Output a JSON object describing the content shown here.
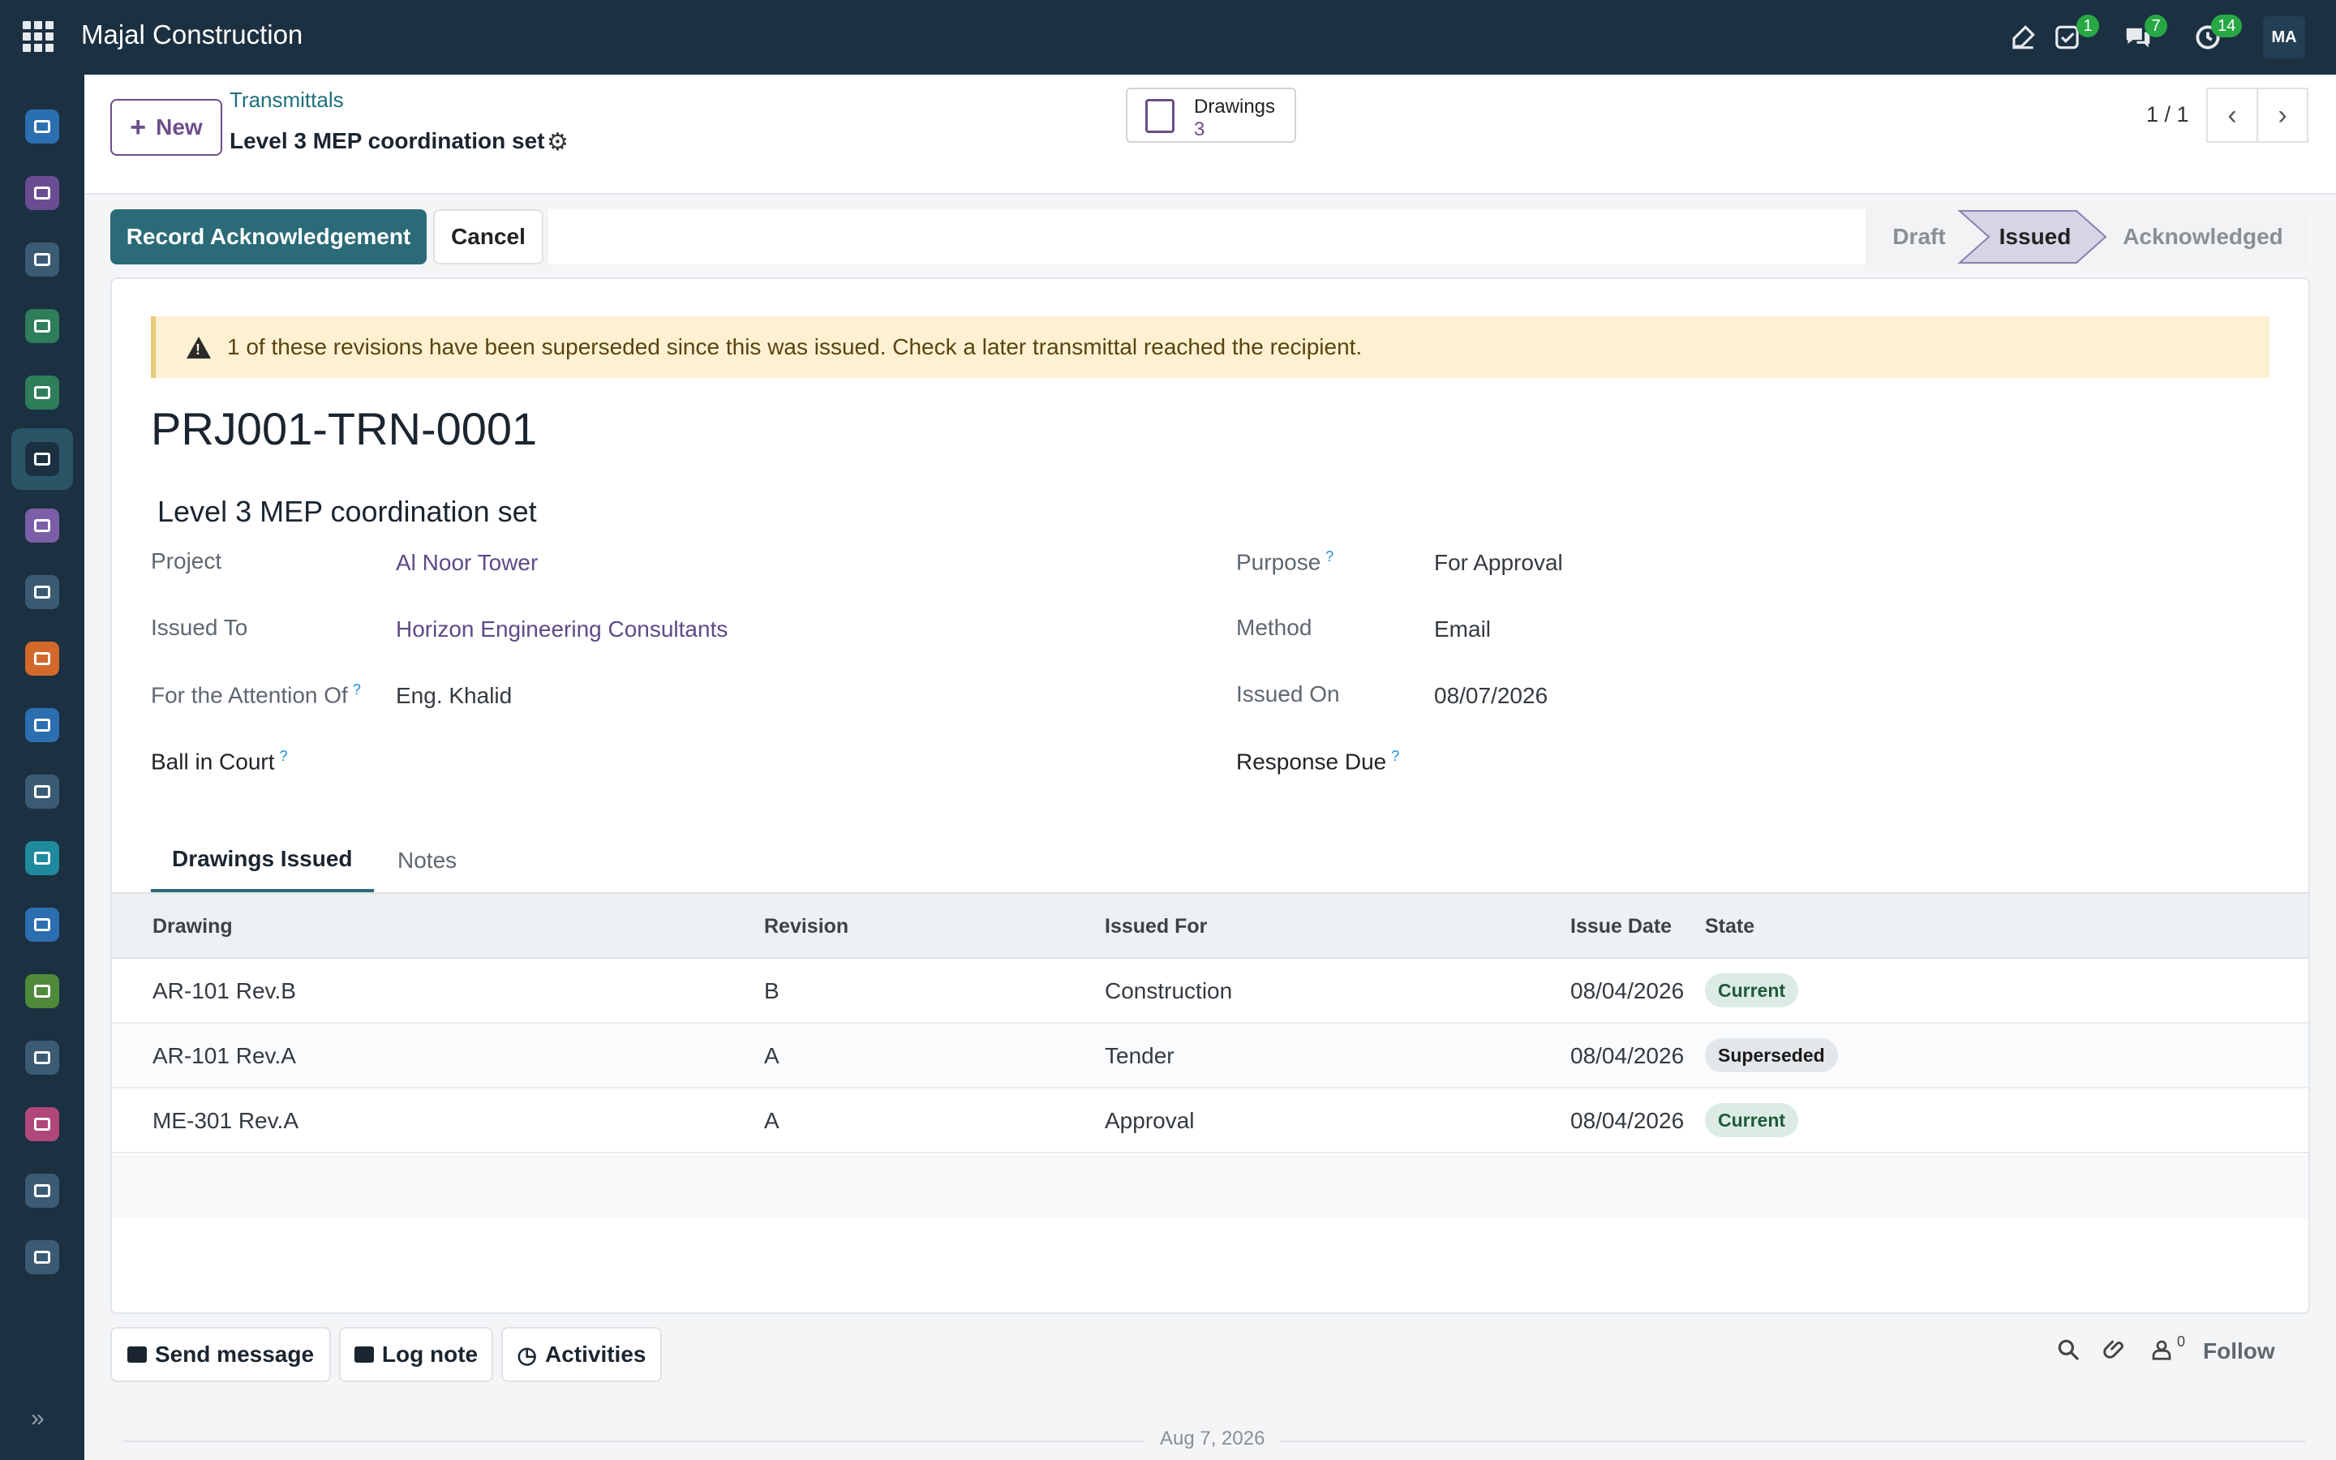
{
  "app": {
    "brand": "Majal Construction",
    "avatar_initials": "MA"
  },
  "topbar": {
    "badges": {
      "activities": "1",
      "messages": "7",
      "clock": "14"
    }
  },
  "sidebar": {
    "items": [
      {
        "name": "discuss",
        "color": "#2c6fb0"
      },
      {
        "name": "shield",
        "color": "#6a4c93"
      },
      {
        "name": "apps",
        "color": "#3b5b73"
      },
      {
        "name": "tasks",
        "color": "#2e7d5b"
      },
      {
        "name": "checklist",
        "color": "#2e7d5b"
      },
      {
        "name": "transmittals",
        "color": "#1b3041",
        "active": true
      },
      {
        "name": "dashboard",
        "color": "#7b5ea7"
      },
      {
        "name": "settings-list",
        "color": "#3b5b73"
      },
      {
        "name": "wallet",
        "color": "#d2692b"
      },
      {
        "name": "link",
        "color": "#2c6fb0"
      },
      {
        "name": "sliders",
        "color": "#3b5b73"
      },
      {
        "name": "web",
        "color": "#1f8a9e"
      },
      {
        "name": "doc-edit",
        "color": "#2c6fb0"
      },
      {
        "name": "house",
        "color": "#4f8a3a"
      },
      {
        "name": "tools",
        "color": "#3b5b73"
      },
      {
        "name": "people",
        "color": "#b0477a"
      },
      {
        "name": "apps-2",
        "color": "#3b5b73"
      },
      {
        "name": "sliders-2",
        "color": "#3b5b73"
      }
    ]
  },
  "control_panel": {
    "new_label": "New",
    "breadcrumb_parent": "Transmittals",
    "breadcrumb_current": "Level 3 MEP coordination set",
    "smart_button": {
      "label": "Drawings",
      "count": "3"
    },
    "pager": "1 / 1"
  },
  "statusbar": {
    "primary_label": "Record Acknowledgement",
    "cancel_label": "Cancel",
    "stages": [
      "Draft",
      "Issued",
      "Acknowledged"
    ],
    "current_stage": "Issued"
  },
  "form": {
    "alert": "1 of these revisions have been superseded since this was issued. Check a later transmittal reached the recipient.",
    "reference": "PRJ001-TRN-0001",
    "subject": "Level 3 MEP coordination set",
    "left_fields": [
      {
        "label": "Project",
        "value": "Al Noor Tower"
      },
      {
        "label": "Issued To",
        "value": "Horizon Engineering Consultants"
      },
      {
        "label": "For the Attention Of",
        "value": "Eng. Khalid"
      },
      {
        "label": "Ball in Court",
        "value": ""
      }
    ],
    "right_fields": [
      {
        "label": "Purpose",
        "value": "For Approval"
      },
      {
        "label": "Method",
        "value": "Email"
      },
      {
        "label": "Issued On",
        "value": "08/07/2026"
      },
      {
        "label": "Response Due",
        "value": ""
      }
    ],
    "help_mark": "?"
  },
  "tabs": [
    {
      "label": "Drawings Issued",
      "active": true
    },
    {
      "label": "Notes",
      "active": false
    }
  ],
  "table": {
    "columns": [
      "Drawing",
      "Revision",
      "Issued For",
      "Issue Date",
      "State"
    ],
    "rows": [
      {
        "drawing": "AR-101 Rev.B",
        "revision": "B",
        "issued_for": "Construction",
        "issue_date": "08/04/2026",
        "state": "Current"
      },
      {
        "drawing": "AR-101 Rev.A",
        "revision": "A",
        "issued_for": "Tender",
        "issue_date": "08/04/2026",
        "state": "Superseded"
      },
      {
        "drawing": "ME-301 Rev.A",
        "revision": "A",
        "issued_for": "Approval",
        "issue_date": "08/04/2026",
        "state": "Current"
      }
    ]
  },
  "chatter": {
    "send_message": "Send message",
    "log_note": "Log note",
    "activities": "Activities",
    "followers_count": "0",
    "follow": "Follow",
    "date_separator": "Aug 7, 2026"
  }
}
